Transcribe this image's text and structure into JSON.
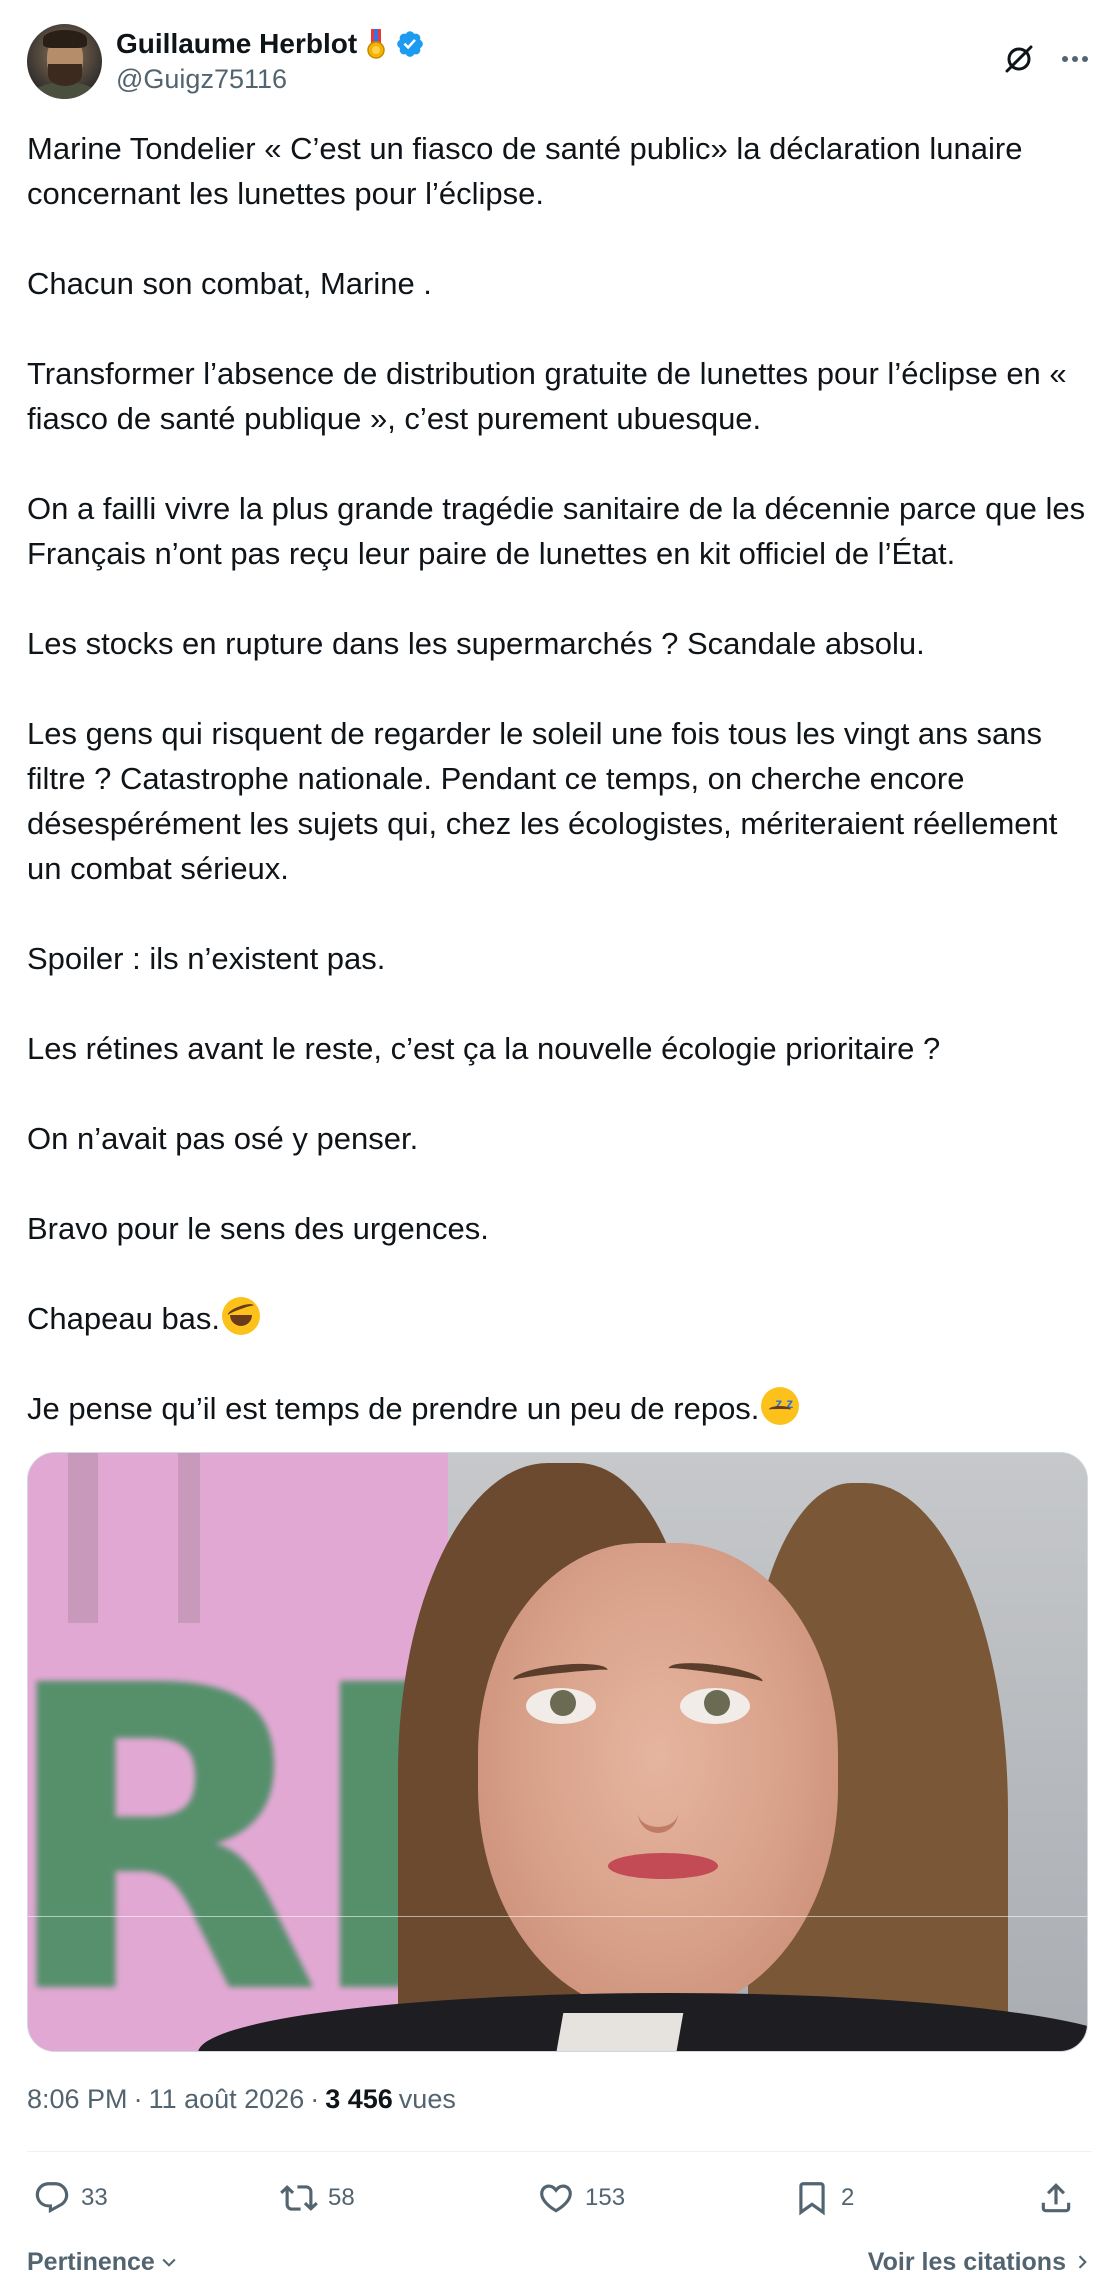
{
  "author": {
    "display_name": "Guillaume Herblot",
    "handle": "@Guigz75116",
    "verified": true,
    "badge_icon": "military-medal-icon"
  },
  "tweet": {
    "paragraphs": [
      "Marine Tondelier « C’est un fiasco de santé public» la déclaration lunaire concernant les lunettes pour l’éclipse.",
      "Chacun son combat, Marine .",
      "Transformer l’absence de distribution gratuite de lunettes pour l’éclipse en « fiasco de santé publique », c’est purement ubuesque.",
      "On a failli vivre la plus grande tragédie sanitaire de la décennie parce que les Français n’ont pas reçu leur paire de lunettes en kit officiel de l’État.",
      "Les stocks en rupture dans les supermarchés ? Scandale absolu.",
      "Les gens qui risquent de regarder le soleil une fois tous les vingt ans sans filtre ? Catastrophe nationale. Pendant ce temps, on cherche encore désespérément les sujets qui, chez les écologistes, mériteraient réellement un combat sérieux.",
      "Spoiler : ils n’existent pas.",
      "Les rétines avant le reste, c’est ça la nouvelle écologie prioritaire ?",
      "On n’avait pas osé y penser.",
      "Bravo pour le sens des urgences.",
      "Chapeau bas.",
      "Je pense qu’il est temps de prendre un peu de repos."
    ],
    "emojis": {
      "p10": "rolling-on-floor-laughing-emoji",
      "p11": "sleeping-face-emoji"
    },
    "media_alt": "woman-looking-up-photo"
  },
  "meta": {
    "time": "8:06 PM",
    "sep1": "·",
    "date": "11 août 2026",
    "sep2": "·",
    "views_count": "3 456",
    "views_label": "vues"
  },
  "actions": {
    "replies": "33",
    "reposts": "58",
    "likes": "153",
    "bookmarks": "2"
  },
  "footer": {
    "sort_label": "Pertinence",
    "quotes_label": "Voir les citations"
  },
  "colors": {
    "text": "#0f1419",
    "secondary": "#536471",
    "verified": "#1d9bf0"
  }
}
